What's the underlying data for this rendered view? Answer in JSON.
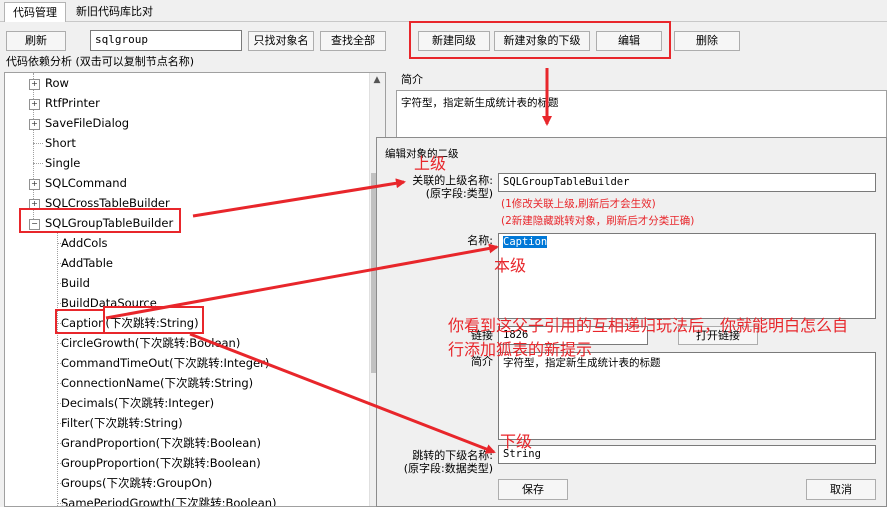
{
  "tabs": [
    "代码管理",
    "新旧代码库比对"
  ],
  "toolbar": {
    "refresh": "刷新",
    "search_value": "sqlgroup",
    "only_object_name": "只找对象名",
    "find_all": "查找全部",
    "new_sibling": "新建同级",
    "new_child": "新建对象的下级",
    "edit": "编辑",
    "delete": "删除"
  },
  "tree": {
    "title": "代码依赖分析 (双击可以复制节点名称)",
    "top_items": [
      "Row",
      "RtfPrinter",
      "SaveFileDialog",
      "Short",
      "Single",
      "SQLCommand",
      "SQLCrossTableBuilder",
      "SQLGroupTableBuilder"
    ],
    "children": [
      "AddCols",
      "AddTable",
      "Build",
      "BuildDataSource",
      "Caption(下次跳转:String)",
      "CircleGrowth(下次跳转:Boolean)",
      "CommandTimeOut(下次跳转:Integer)",
      "ConnectionName(下次跳转:String)",
      "Decimals(下次跳转:Integer)",
      "Filter(下次跳转:String)",
      "GrandProportion(下次跳转:Boolean)",
      "GroupProportion(下次跳转:Boolean)",
      "Groups(下次跳转:GroupOn)",
      "SamePeriodGrowth(下次跳转:Boolean)"
    ]
  },
  "summary": {
    "label": "简介",
    "text": "字符型，指定新生成统计表的标题"
  },
  "dialog": {
    "title": "编辑对象的二级",
    "parent_label_1": "关联的上级名称:",
    "parent_label_2": "(原字段:类型)",
    "parent_value": "SQLGroupTableBuilder",
    "note_1": "(1修改关联上级,刷新后才会生效)",
    "note_2": "(2新建隐藏跳转对象，刷新后才分类正确)",
    "name_label": "名称:",
    "name_value": "Caption",
    "link_label": "链接",
    "link_value": "1826",
    "open_link": "打开链接",
    "intro_label": "简介",
    "intro_value": "字符型，指定新生成统计表的标题",
    "jump_label_1": "跳转的下级名称:",
    "jump_label_2": "(原字段:数据类型)",
    "jump_value": "String",
    "save": "保存",
    "cancel": "取消"
  },
  "annotations": {
    "upper": "上级",
    "this": "本级",
    "lower": "下级",
    "message": "你看到这父子引用的互相递归玩法后，你就能明白怎么自行添加狐表的新提示"
  },
  "colors": {
    "annotation": "#e8262b",
    "selection": "#0078d7"
  }
}
